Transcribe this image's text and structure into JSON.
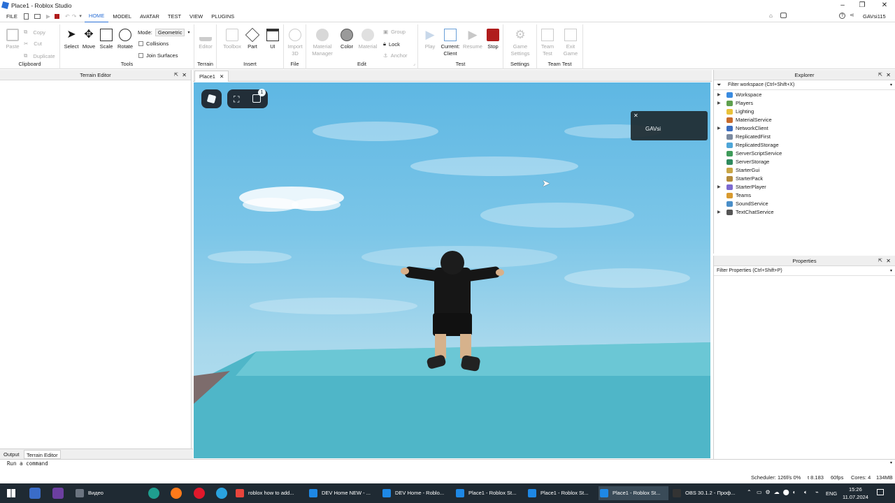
{
  "window": {
    "title": "Place1 - Roblox Studio"
  },
  "menu": [
    "FILE",
    "HOME",
    "MODEL",
    "AVATAR",
    "TEST",
    "VIEW",
    "PLUGINS"
  ],
  "active_menu": "HOME",
  "user": "GAVsi115",
  "ribbon": {
    "clipboard": {
      "label": "Clipboard",
      "paste": "Paste",
      "copy": "Copy",
      "cut": "Cut",
      "duplicate": "Duplicate"
    },
    "tools": {
      "label": "Tools",
      "select": "Select",
      "move": "Move",
      "scale": "Scale",
      "rotate": "Rotate",
      "mode_label": "Mode:",
      "mode_value": "Geometric",
      "collisions": "Collisions",
      "join": "Join Surfaces"
    },
    "terrain": {
      "label": "Terrain",
      "editor": "Editor"
    },
    "insert": {
      "label": "Insert",
      "toolbox": "Toolbox",
      "part": "Part",
      "ui": "UI"
    },
    "file": {
      "label": "File",
      "import": "Import",
      "import2": "3D"
    },
    "edit": {
      "label": "Edit",
      "material_manager": "Material",
      "material_manager2": "Manager",
      "color": "Color",
      "material": "Material",
      "group": "Group",
      "lock": "Lock",
      "anchor": "Anchor"
    },
    "test": {
      "label": "Test",
      "play": "Play",
      "current": "Current:",
      "client": "Client",
      "resume": "Resume",
      "stop": "Stop"
    },
    "settings": {
      "label": "Settings",
      "game": "Game",
      "settings": "Settings"
    },
    "teamtest": {
      "label": "Team Test",
      "team": "Team",
      "test": "Test",
      "exit": "Exit",
      "game": "Game"
    }
  },
  "left_panel": {
    "title": "Terrain Editor"
  },
  "doc_tab": "Place1",
  "notification": {
    "name": "GAVsi"
  },
  "chat_badge": "1",
  "explorer": {
    "title": "Explorer",
    "filter": "Filter workspace (Ctrl+Shift+X)",
    "items": [
      {
        "label": "Workspace",
        "expandable": true,
        "color": "#3a8be0"
      },
      {
        "label": "Players",
        "expandable": true,
        "color": "#5fa04e"
      },
      {
        "label": "Lighting",
        "expandable": false,
        "color": "#e9c23b"
      },
      {
        "label": "MaterialService",
        "expandable": false,
        "color": "#c86b2b"
      },
      {
        "label": "NetworkClient",
        "expandable": true,
        "color": "#3c6ec0"
      },
      {
        "label": "ReplicatedFirst",
        "expandable": false,
        "color": "#7b8aa0"
      },
      {
        "label": "ReplicatedStorage",
        "expandable": false,
        "color": "#4ea6d8"
      },
      {
        "label": "ServerScriptService",
        "expandable": false,
        "color": "#3f9b5a"
      },
      {
        "label": "ServerStorage",
        "expandable": false,
        "color": "#2f8a5e"
      },
      {
        "label": "StarterGui",
        "expandable": false,
        "color": "#c9a646"
      },
      {
        "label": "StarterPack",
        "expandable": false,
        "color": "#b48a3a"
      },
      {
        "label": "StarterPlayer",
        "expandable": true,
        "color": "#7d6ad0"
      },
      {
        "label": "Teams",
        "expandable": false,
        "color": "#d89a2f"
      },
      {
        "label": "SoundService",
        "expandable": false,
        "color": "#4a8ec8"
      },
      {
        "label": "TextChatService",
        "expandable": true,
        "color": "#555555"
      }
    ]
  },
  "properties": {
    "title": "Properties",
    "filter": "Filter Properties (Ctrl+Shift+P)"
  },
  "bottom_tabs": [
    "Output",
    "Terrain Editor"
  ],
  "command_bar": {
    "placeholder": "Run a command"
  },
  "status": {
    "scheduler": "Scheduler: 126f/s 0%",
    "t": "t 8.183",
    "fps": "60fps",
    "cores": "Cores: 4",
    "mem": "134MB"
  },
  "taskbar": {
    "apps": [
      {
        "label": "Видео",
        "color": "#6b7480"
      },
      {
        "label": "roblox how to add...",
        "color": "#e8453c"
      },
      {
        "label": "DEV Home NEW - ...",
        "color": "#1e88e5"
      },
      {
        "label": "DEV Home - Roblo...",
        "color": "#1e88e5"
      },
      {
        "label": "Place1 - Roblox St...",
        "color": "#1e88e5"
      },
      {
        "label": "Place1 - Roblox St...",
        "color": "#1e88e5"
      },
      {
        "label": "Place1 - Roblox St...",
        "color": "#1e88e5"
      },
      {
        "label": "OBS 30.1.2 - Проф...",
        "color": "#333333"
      }
    ],
    "lang": "ENG",
    "time": "15:26",
    "date": "11.07.2024"
  }
}
